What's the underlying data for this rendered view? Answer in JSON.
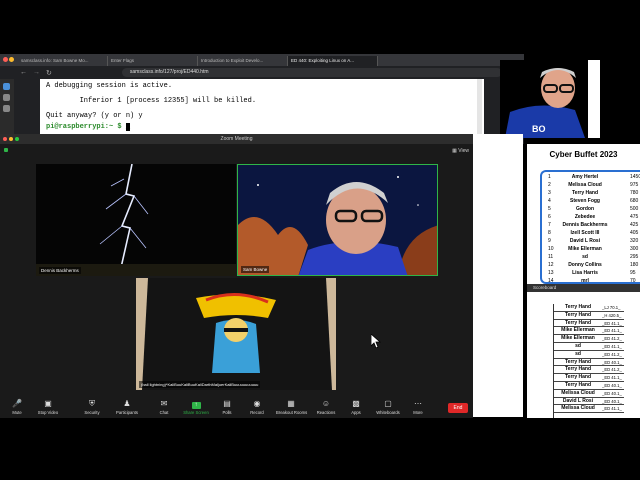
{
  "browser": {
    "tabs": [
      "samsclass.info: Sam Bowne Mo...",
      "Enter Flags",
      "Introduction to Exploit Develo...",
      "ED 440: Exploiting Linux on A..."
    ],
    "active_tab": 3,
    "url": "samsclass.info/127/proj/ED440.htm"
  },
  "terminal": {
    "line1": "A debugging session is active.",
    "line2": "        Inferior 1 [process 12355] will be killed.",
    "line3": "Quit anyway? (y or n) y",
    "prompt": "pi@raspberrypi:~ $"
  },
  "zoom": {
    "window_title": "Zoom Meeting",
    "view_label": "View",
    "participants": [
      {
        "name": "Dennis Backherms"
      },
      {
        "name": "Sam Bowne"
      },
      {
        "name": "(ball lightning)*KaliBuuKaliBuuKaliDarthMaljuerKaliBuuuuuuuuuuu"
      }
    ],
    "toolbar": [
      {
        "label": "Mute",
        "icon": "microphone-icon"
      },
      {
        "label": "Stop Video",
        "icon": "video-icon"
      },
      {
        "label": "Security",
        "icon": "shield-icon"
      },
      {
        "label": "Participants",
        "icon": "people-icon"
      },
      {
        "label": "Chat",
        "icon": "chat-icon"
      },
      {
        "label": "Share Screen",
        "icon": "share-icon"
      },
      {
        "label": "Polls",
        "icon": "polls-icon"
      },
      {
        "label": "Record",
        "icon": "record-icon"
      },
      {
        "label": "Breakout Rooms",
        "icon": "breakout-icon"
      },
      {
        "label": "Reactions",
        "icon": "reactions-icon"
      },
      {
        "label": "Apps",
        "icon": "apps-icon"
      },
      {
        "label": "Whiteboards",
        "icon": "whiteboard-icon"
      },
      {
        "label": "More",
        "icon": "more-icon"
      }
    ],
    "end_label": "End",
    "colors": {
      "share_green": "#2fb548",
      "end_red": "#e02828"
    }
  },
  "cyber_buffet": {
    "title": "Cyber Buffet 2023",
    "rows": [
      {
        "rank": "1",
        "name": "Amy Hertel",
        "score": "1450"
      },
      {
        "rank": "2",
        "name": "Melissa Cloud",
        "score": "975"
      },
      {
        "rank": "3",
        "name": "Terry Hand",
        "score": "780"
      },
      {
        "rank": "4",
        "name": "Steven Fogg",
        "score": "680"
      },
      {
        "rank": "5",
        "name": "Gordon",
        "score": "500"
      },
      {
        "rank": "6",
        "name": "Zebedee",
        "score": "475"
      },
      {
        "rank": "7",
        "name": "Dennis Backherms",
        "score": "425"
      },
      {
        "rank": "8",
        "name": "Izell Scott III",
        "score": "405"
      },
      {
        "rank": "9",
        "name": "David L Rosi",
        "score": "320"
      },
      {
        "rank": "10",
        "name": "Mike Ellerman",
        "score": "300"
      },
      {
        "rank": "11",
        "name": "sd",
        "score": "295"
      },
      {
        "rank": "12",
        "name": "Donny Collins",
        "score": "180"
      },
      {
        "rank": "13",
        "name": "Lisa Harris",
        "score": "95"
      },
      {
        "rank": "14",
        "name": "mrl",
        "score": "70"
      }
    ],
    "accent": "#2a6fd1"
  },
  "scoreboard": {
    "title": "Scoreboard",
    "rows": [
      {
        "name": "Terry Hand",
        "event": "_LJ 70.1_"
      },
      {
        "name": "Terry Hand",
        "event": "_H 420.5_"
      },
      {
        "name": "Terry Hand",
        "event": "_ED 41.1_"
      },
      {
        "name": "Mike Ellerman",
        "event": "_ED 41.1_"
      },
      {
        "name": "Mike Ellerman",
        "event": "_ED 41.2_"
      },
      {
        "name": "sd",
        "event": "_ED 41.1_"
      },
      {
        "name": "sd",
        "event": "_ED 41.2_"
      },
      {
        "name": "Terry Hand",
        "event": "_ED 40.1_"
      },
      {
        "name": "Terry Hand",
        "event": "_ED 41.2_"
      },
      {
        "name": "Terry Hand",
        "event": "_ED 41.1_"
      },
      {
        "name": "Terry Hand",
        "event": "_ED 40.1_"
      },
      {
        "name": "Melissa Cloud",
        "event": "_ED 40.1_"
      },
      {
        "name": "David L Rosi",
        "event": "_ED 40.1_"
      },
      {
        "name": "Melissa Cloud",
        "event": "_ED 41.1_"
      }
    ]
  }
}
